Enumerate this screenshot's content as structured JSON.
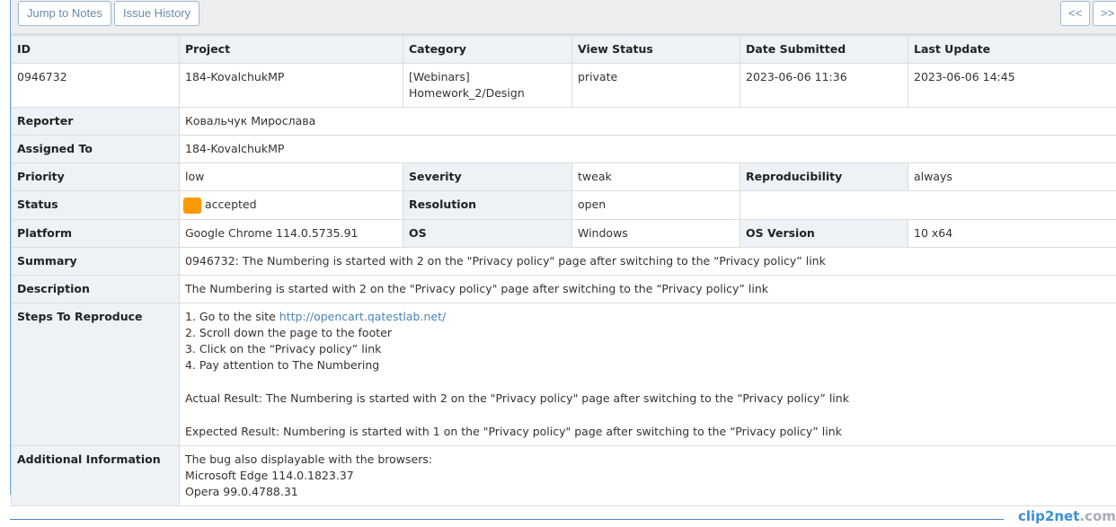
{
  "toolbar": {
    "jump_to_notes": "Jump to Notes",
    "issue_history": "Issue History",
    "prev": "<<",
    "next": ">>"
  },
  "headers": [
    "ID",
    "Project",
    "Category",
    "View Status",
    "Date Submitted",
    "Last Update"
  ],
  "values": [
    "0946732",
    "184-KovalchukMP",
    "[Webinars]\nHomework_2/Design",
    "private",
    "2023-06-06 11:36",
    "2023-06-06 14:45"
  ],
  "reporter": {
    "label": "Reporter",
    "value": "Ковальчук Мирослава"
  },
  "assigned": {
    "label": "Assigned To",
    "value": "184-KovalchukMP"
  },
  "priority": {
    "label": "Priority",
    "value": "low",
    "severity_label": "Severity",
    "severity": "tweak",
    "repro_label": "Reproducibility",
    "repro": "always"
  },
  "status": {
    "label": "Status",
    "value": "accepted",
    "color": "#ff9900",
    "resolution_label": "Resolution",
    "resolution": "open"
  },
  "platform": {
    "label": "Platform",
    "value": "Google Chrome 114.0.5735.91",
    "os_label": "OS",
    "os": "Windows",
    "osv_label": "OS Version",
    "osv": "10 x64"
  },
  "summary": {
    "label": "Summary",
    "value": "0946732: The Numbering is started with 2 on the \"Privacy policy\" page after switching to the “Privacy policy” link"
  },
  "description": {
    "label": "Description",
    "value": "The Numbering is started with 2 on the \"Privacy policy\" page after switching to the “Privacy policy” link"
  },
  "steps": {
    "label": "Steps To Reproduce",
    "step1_prefix": "1. Go to the site ",
    "step1_link": "http://opencart.qatestlab.net/",
    "step2": "2. Scroll down the page to the footer",
    "step3": "3. Click on the “Privacy policy” link",
    "step4": "4. Pay attention to The Numbering",
    "actual": "Actual Result: The Numbering is started with 2 on the \"Privacy policy\" page after switching to the “Privacy policy” link",
    "expected": "Expected Result: Numbering is started with 1 on the \"Privacy policy\" page after switching to the “Privacy policy” link"
  },
  "additional": {
    "label": "Additional Information",
    "line1": "The bug also displayable with the browsers:",
    "line2": "Microsoft Edge 114.0.1823.37",
    "line3": "Opera 99.0.4788.31"
  },
  "watermark": {
    "brand": "clip2net",
    ".com": ".com"
  }
}
